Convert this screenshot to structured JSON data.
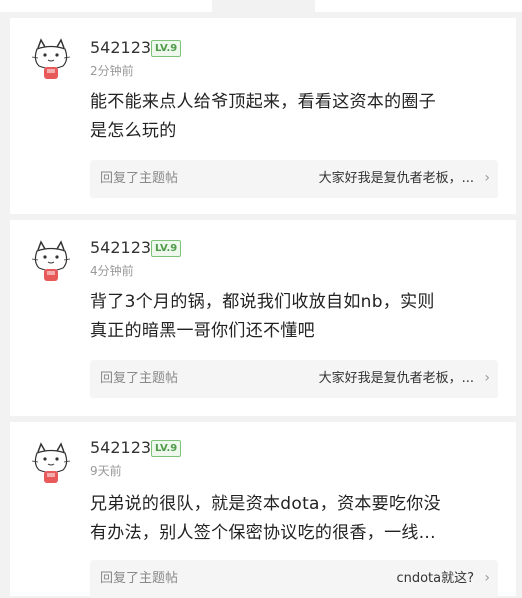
{
  "posts": [
    {
      "username": "542123",
      "level": "LV.9",
      "time": "2分钟前",
      "content_line1": "能不能来点人给爷顶起来，看看这资本的圈子",
      "content_line2": "是怎么玩的",
      "reply_label": "回复了主题帖",
      "reply_topic": "大家好我是复仇者老板，..."
    },
    {
      "username": "542123",
      "level": "LV.9",
      "time": "4分钟前",
      "content_line1": "背了3个月的锅，都说我们收放自如nb，实则",
      "content_line2": "真正的暗黑一哥你们还不懂吧",
      "reply_label": "回复了主题帖",
      "reply_topic": "大家好我是复仇者老板，..."
    },
    {
      "username": "542123",
      "level": "LV.9",
      "time": "9天前",
      "content_line1": "兄弟说的很队，就是资本dota，资本要吃你没",
      "content_line2": "有办法，别人签个保密协议吃的很香，一线...",
      "reply_label": "回复了主题帖",
      "reply_topic": "cndota就这?"
    }
  ],
  "icons": {
    "avatar": "cat-avatar-icon",
    "chevron": "chevron-right-icon",
    "chevron_glyph": "›"
  },
  "colors": {
    "level_badge": "#4f9a4a",
    "background": "#f2f2f2"
  }
}
